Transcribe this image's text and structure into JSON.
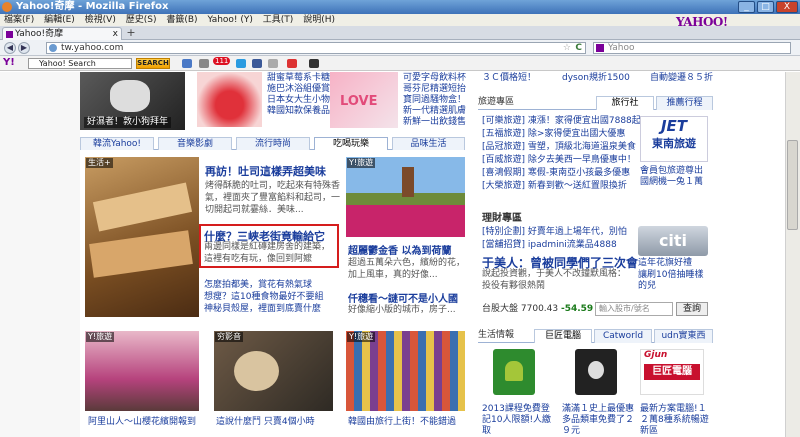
{
  "window": {
    "title": "Yahoo!奇摩 - Mozilla Firefox",
    "min": "_",
    "max": "□",
    "close": "X"
  },
  "menu": [
    "檔案(F)",
    "編輯(E)",
    "檢視(V)",
    "歷史(S)",
    "書籤(B)",
    "Yahoo! (Y)",
    "工具(T)",
    "說明(H)"
  ],
  "brand": "YAHOO!",
  "tab": {
    "label": "Yahoo!奇摩",
    "close": "x",
    "new": "+"
  },
  "nav": {
    "back": "◀",
    "forward": "▶",
    "url": "tw.yahoo.com",
    "star": "☆",
    "reload": "C",
    "search_placeholder": "Yahoo"
  },
  "toolbar": {
    "search_placeholder": "Yahoo! Search",
    "search_button": "SEARCH",
    "mail_badge": "111",
    "y_icon": "Y!"
  },
  "top_left": {
    "caption": "好濕者！敦小狗拜年",
    "links": [
      "甜蜜草莓系卡糖",
      "施巴沐浴組優賞",
      "日本女大生小物",
      "韓國知款保養品"
    ]
  },
  "top_right_links": [
    "可愛字母飲料杯",
    "哥芬尼精選短抬",
    "寶同過騷物盒！",
    "新一代精選肌膚",
    "新鮮一出飲錢售"
  ],
  "channel_tabs": [
    "韓流Yahoo!",
    "音樂影劇",
    "流行時尚",
    "吃喝玩樂",
    "品味生活"
  ],
  "main_story": {
    "badge": "生活+",
    "title": "再訪！吐司這樣弄超美味",
    "body": "烤得酥脆的吐司，吃起來有特殊香氣，裡面夾了豐富餡料和起司，一切開起司就霎絲．美味...",
    "sub_title": "什麼？三峽老街竟輸給它",
    "sub_body": "兩邊同樣是紅磚建房舍的建築，這裡有吃有玩，像回到阿嬤",
    "bullets": [
      "怎麼拍都美，賞花有熱氣球",
      "想瘦？這10種食物最好不要組",
      "神秘貝殼屋，裡面到底賣什麼"
    ]
  },
  "side_story": {
    "badge": "Y!旅遊",
    "title": "超麗鬱金香 以為到荷蘭",
    "body": "超過五萬朵六色，繽紛的花，加上風車，真的好像...",
    "title2": "仟穗看～謎可不是小人國",
    "body2": "好像縮小版的城市，房子..."
  },
  "bottom_photos": [
    {
      "badge": "Y!旅遊",
      "caption": "阿里山人～山櫻花繽開報到"
    },
    {
      "badge": "穷影音",
      "caption": "這說什麼鬥 只賣4個小時"
    },
    {
      "badge": "Y!旅遊",
      "caption": "韓國由旅行上街！不能錯過"
    }
  ],
  "right_top": {
    "line1": "３Ｃ價格短！",
    "line2": "dyson規折1500",
    "line3": "自動變遷８５折"
  },
  "travel": {
    "tabs": [
      "旅遊專區",
      "旅行社",
      "推薦行程"
    ],
    "lines": [
      "[可樂旅遊] 凍漲！家得便宜出國7888起",
      "[五福旅遊] 除>家得便宜出國大優惠",
      "[品冠旅遊] 雪塑，頂級北海道溫泉美食",
      "[百威旅遊] 除夕去美西一早鳥優惠中！",
      "[喜鴻假期] 寒假-東南亞小孩最多優惠",
      "[大榮旅遊] 新春到歡～送紅置限換折"
    ],
    "logo_line1": "JET",
    "logo_line2": "東南旅遊",
    "promo": "會員包旅遊尊出國網機一兔１萬"
  },
  "finance": {
    "title": "理財專區",
    "lines": [
      "[特別企劃] 好賣年過上場年代，別怕",
      "[當舖招貸] ipadmini流業品4888"
    ],
    "head": "于美人：曾被同學們了三次會",
    "body": "說起投資觀，于美人不改鐘默風格：投役有夥很熱鬧",
    "citi_text": "這年花旗好禮",
    "citi_promo": "讓刷10倍抽睡樣的兒",
    "stock_label": "台股大盤",
    "stock_value": "7700.43",
    "stock_change": "-54.59",
    "stock_placeholder": "輸入股市/號名",
    "stock_button": "查詢"
  },
  "life": {
    "tabs": [
      "生活情報",
      "巨匠電腦",
      "Catworld",
      "udn實東西"
    ],
    "cards": [
      "2013課程免費登記10人限額!人繳取",
      "滿滿１史上最優惠多品類車免費了２９元",
      "最新方案電腦!１２萬8種系統暢遊新區"
    ],
    "logo_text": "巨匠電腦",
    "logo_top": "Gjun"
  }
}
